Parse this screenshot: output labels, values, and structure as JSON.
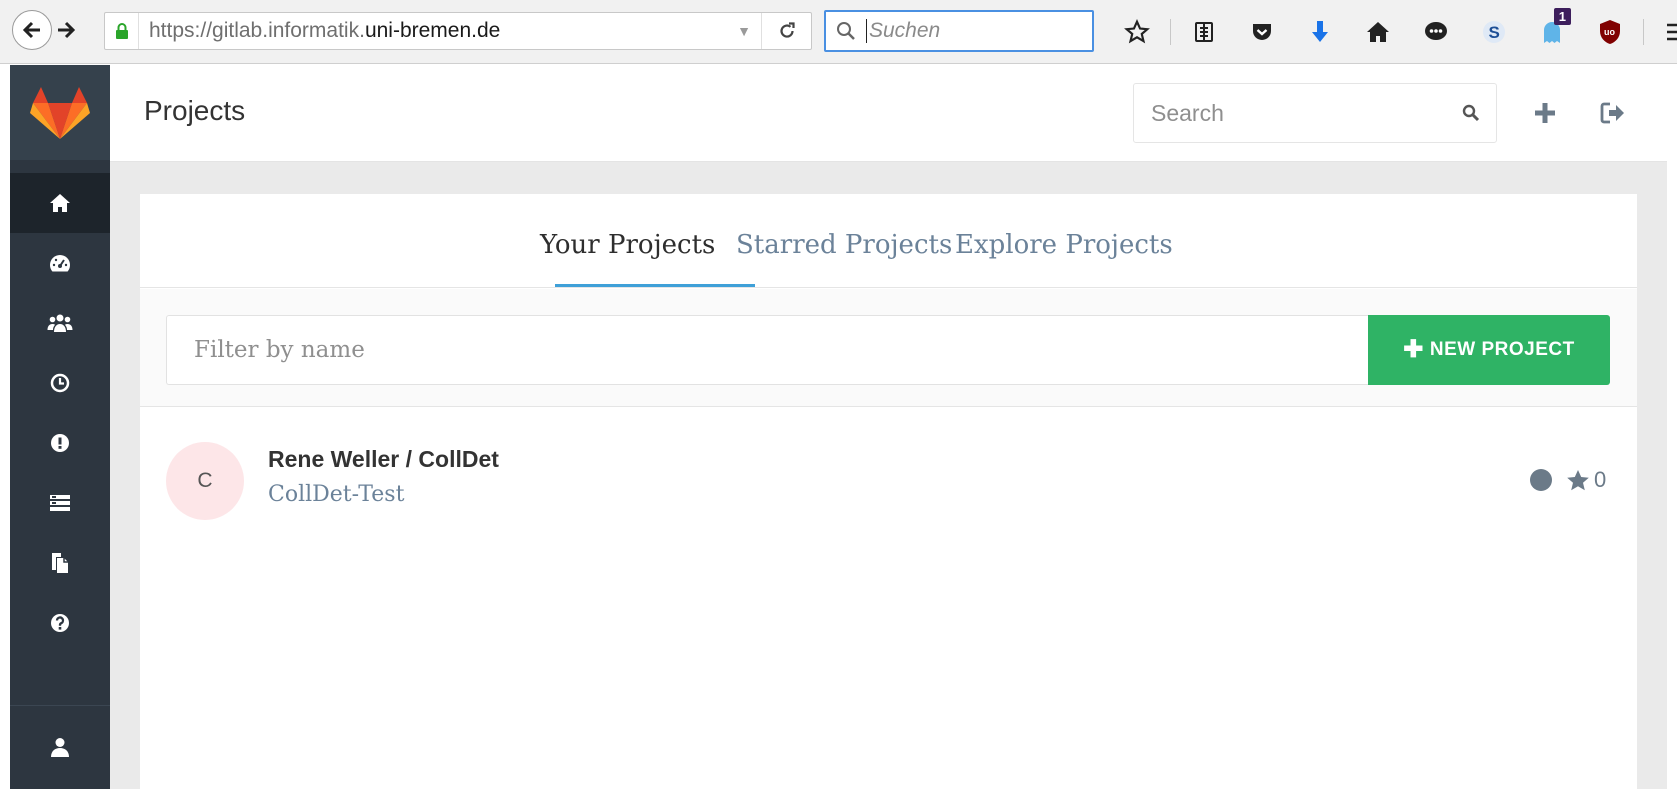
{
  "browser": {
    "url_prefix": "https://gitlab.informatik.",
    "url_domain": "uni-bremen.de",
    "search_placeholder": "Suchen",
    "notification_badge": "1"
  },
  "header": {
    "title": "Projects",
    "search_placeholder": "Search"
  },
  "tabs": [
    {
      "label": "Your Projects",
      "active": true
    },
    {
      "label": "Starred Projects",
      "active": false
    },
    {
      "label": "Explore Projects",
      "active": false
    }
  ],
  "filter": {
    "placeholder": "Filter by name",
    "new_project_label": "NEW PROJECT"
  },
  "projects": [
    {
      "avatar_letter": "C",
      "name": "Rene Weller / CollDet",
      "description": "CollDet-Test",
      "stars": "0"
    }
  ],
  "colors": {
    "sidebar_bg": "#2d3640",
    "accent_green": "#2fb365",
    "active_tab_underline": "#3fa0d8",
    "link_blue_gray": "#6b8299"
  },
  "icons": {
    "sidebar": [
      "home-icon",
      "dashboard-icon",
      "groups-icon",
      "activity-icon",
      "issues-icon",
      "merge-requests-icon",
      "snippets-icon",
      "help-icon",
      "profile-icon"
    ],
    "header": [
      "search-icon",
      "plus-icon",
      "sign-out-icon"
    ]
  }
}
